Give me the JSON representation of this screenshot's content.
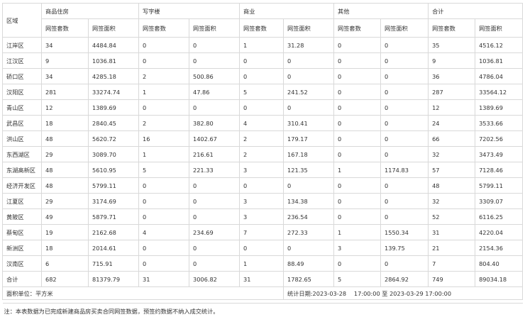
{
  "header": {
    "district": "区域",
    "groups": [
      "商品住房",
      "写字楼",
      "商业",
      "其他",
      "合计"
    ],
    "sub": [
      "网签套数",
      "网签面积"
    ]
  },
  "rows": [
    {
      "district": "江岸区",
      "cells": [
        "34",
        "4484.84",
        "0",
        "0",
        "1",
        "31.28",
        "0",
        "0",
        "35",
        "4516.12"
      ]
    },
    {
      "district": "江汉区",
      "cells": [
        "9",
        "1036.81",
        "0",
        "0",
        "0",
        "0",
        "0",
        "0",
        "9",
        "1036.81"
      ]
    },
    {
      "district": "硚口区",
      "cells": [
        "34",
        "4285.18",
        "2",
        "500.86",
        "0",
        "0",
        "0",
        "0",
        "36",
        "4786.04"
      ]
    },
    {
      "district": "汉阳区",
      "cells": [
        "281",
        "33274.74",
        "1",
        "47.86",
        "5",
        "241.52",
        "0",
        "0",
        "287",
        "33564.12"
      ]
    },
    {
      "district": "青山区",
      "cells": [
        "12",
        "1389.69",
        "0",
        "0",
        "0",
        "0",
        "0",
        "0",
        "12",
        "1389.69"
      ]
    },
    {
      "district": "武昌区",
      "cells": [
        "18",
        "2840.45",
        "2",
        "382.80",
        "4",
        "310.41",
        "0",
        "0",
        "24",
        "3533.66"
      ]
    },
    {
      "district": "洪山区",
      "cells": [
        "48",
        "5620.72",
        "16",
        "1402.67",
        "2",
        "179.17",
        "0",
        "0",
        "66",
        "7202.56"
      ]
    },
    {
      "district": "东西湖区",
      "cells": [
        "29",
        "3089.70",
        "1",
        "216.61",
        "2",
        "167.18",
        "0",
        "0",
        "32",
        "3473.49"
      ]
    },
    {
      "district": "东湖高新区",
      "cells": [
        "48",
        "5610.95",
        "5",
        "221.33",
        "3",
        "121.35",
        "1",
        "1174.83",
        "57",
        "7128.46"
      ]
    },
    {
      "district": "经济开发区",
      "cells": [
        "48",
        "5799.11",
        "0",
        "0",
        "0",
        "0",
        "0",
        "0",
        "48",
        "5799.11"
      ]
    },
    {
      "district": "江夏区",
      "cells": [
        "29",
        "3174.69",
        "0",
        "0",
        "3",
        "134.38",
        "0",
        "0",
        "32",
        "3309.07"
      ]
    },
    {
      "district": "黄陂区",
      "cells": [
        "49",
        "5879.71",
        "0",
        "0",
        "3",
        "236.54",
        "0",
        "0",
        "52",
        "6116.25"
      ]
    },
    {
      "district": "蔡甸区",
      "cells": [
        "19",
        "2162.68",
        "4",
        "234.69",
        "7",
        "272.33",
        "1",
        "1550.34",
        "31",
        "4220.04"
      ]
    },
    {
      "district": "新洲区",
      "cells": [
        "18",
        "2014.61",
        "0",
        "0",
        "0",
        "0",
        "3",
        "139.75",
        "21",
        "2154.36"
      ]
    },
    {
      "district": "汉南区",
      "cells": [
        "6",
        "715.91",
        "0",
        "0",
        "1",
        "88.49",
        "0",
        "0",
        "7",
        "804.40"
      ]
    }
  ],
  "total": {
    "district": "合计",
    "cells": [
      "682",
      "81379.79",
      "31",
      "3006.82",
      "31",
      "1782.65",
      "5",
      "2864.92",
      "749",
      "89034.18"
    ]
  },
  "footer": {
    "unit": "面积单位：平方米",
    "period": "统计日期:2023-03-28　 17:00:00 至 2023-03-29 17:00:00"
  },
  "note": "注：本表数据为已完成新建商品房买卖合同网签数据，预签约数据不纳入成交统计。"
}
